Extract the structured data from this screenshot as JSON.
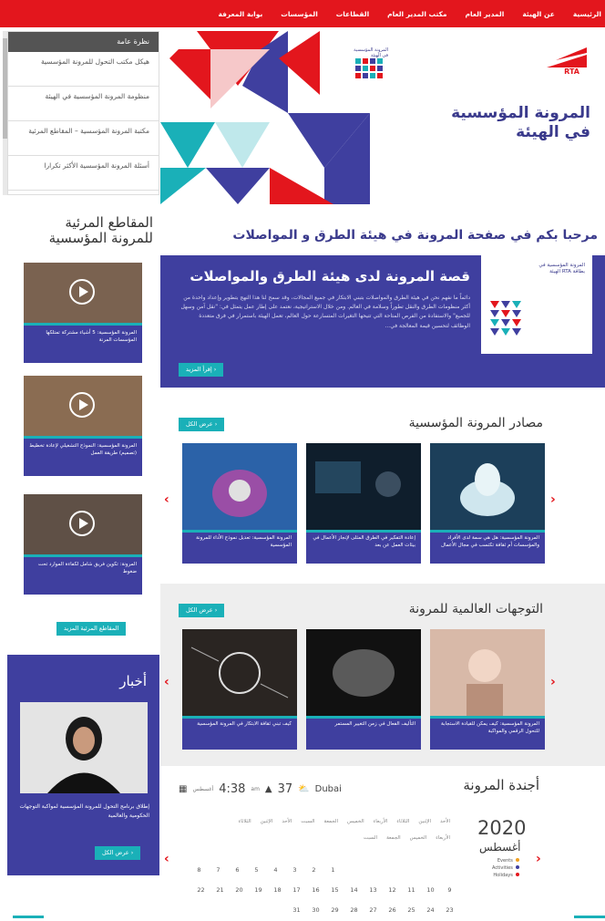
{
  "nav": {
    "items": [
      "الرئيسية",
      "عن الهيئة",
      "المدير العام",
      "مكتب المدير العام",
      "القطاعات",
      "المؤسسات",
      "بوابة المعرفة"
    ]
  },
  "sidebar_menu": {
    "header": "نظرة عامة",
    "items": [
      "هيكل مكتب التحول للمرونة المؤسسية",
      "منظومة المرونة المؤسسية في الهيئة",
      "مكتبة المرونة المؤسسية – المقاطع المرئية",
      "أسئلة المرونة المؤسسية الأكثر تكرارا"
    ]
  },
  "hero": {
    "title_line1": "المرونة المؤسسية",
    "title_line2": "في الهيئة",
    "logo_text": "RTA",
    "sub_label": "المرونة المؤسسية في الهيئة"
  },
  "welcome": "مرحبا بكم في صفحة المرونة في هيئة الطرق و المواصلات",
  "story": {
    "title": "قصة المرونة لدى هيئة الطرق والمواصلات",
    "body": "دائماً ما نفهم نحن في هيئة الطرق والمواصلات بتبني الابتكار في جميع المجالات، وقد سمح لنا هذا النهج بتطوير وإعداد واحدة من أكثر منظومات الطرق والنقل تطوراً وسلامة في العالم. ومن خلال الاستراتيجية، نعتمد على إطار عمل يتمثل في: \"نقل آمن وسهل للجميع\" والاستفادة من الفرص المتاحة التي تتيحها التغيرات المتسارعة حول العالم، تعمل الهيئة باستمرار في فرق متعددة الوظائف لتحسين قيمة المعالجة في...",
    "button": "إقرأ المزيد",
    "card_label": "المرونة المؤسسية في الهيئة RTA بطاقة"
  },
  "sources": {
    "title": "مصادر المرونة المؤسسية",
    "view_all": "عرض الكل",
    "cards": [
      "المرونة المؤسسية: هل هي سمة لدى الأفراد والمؤسسات أم ثقافة تكتسب في مجال الأعمال",
      "إعادة التفكير في الطرق المثلى لإنجاز الأعمال في بيئات العمل عن بعد",
      "المرونة المؤسسية: تعديل نموذج الأداء للمرونة المؤسسية"
    ]
  },
  "trends": {
    "title": "التوجهات العالمية للمرونة",
    "view_all": "عرض الكل",
    "cards": [
      "المرونة المؤسسية: كيف يمكن للقيادة الاستجابة للتحول الرقمي والمواكبة",
      "التأليف الفعال في زمن التغيير المستمر",
      "كيف تبني ثقافة الابتكار في المرونة المؤسسية"
    ]
  },
  "videos": {
    "title_line1": "المقاطع المرئية",
    "title_line2": "للمرونة المؤسسية",
    "items": [
      "المرونة المؤسسية: 5 أشياء مشتركة تمتلكها المؤسسات المرنة",
      "المرونة المؤسسية: النموذج التشغيلي لإعادة تخطيط (تصميم) طريقة العمل",
      "المرونة: تكوين فريق شامل لكفاءة الموارد تحت ضغوط"
    ],
    "button": "المقاطع المرئية المزيد"
  },
  "news": {
    "title": "أخبار",
    "caption": "إطلاق برنامج التحول للمرونة المؤسسية لمواكبة التوجهات الحكومية والعالمية",
    "button": "عرض الكل"
  },
  "agenda": {
    "title": "أجندة المرونة",
    "year": "2020",
    "month": "أغسطس",
    "legend": [
      "Events",
      "Activities",
      "Holidays"
    ],
    "days_row1": [
      "الأحد",
      "الإثنين",
      "الثلاثاء",
      "الأربعاء",
      "الخميس",
      "الجمعة",
      "السبت",
      "الأحد",
      "الإثنين",
      "الثلاثاء"
    ],
    "days_row2": [
      "الأربعاء",
      "الخميس",
      "الجمعة",
      "السبت"
    ],
    "week1": [
      "1",
      "2",
      "3",
      "4",
      "5",
      "6",
      "7",
      "8"
    ],
    "week2": [
      "9",
      "10",
      "11",
      "12",
      "13",
      "14",
      "15",
      "16",
      "17",
      "18",
      "19",
      "20",
      "21",
      "22"
    ],
    "week3": [
      "23",
      "24",
      "25",
      "26",
      "27",
      "28",
      "29",
      "30",
      "31"
    ]
  },
  "weather": {
    "city": "Dubai",
    "temp": "37",
    "time": "4:38",
    "ampm": "am",
    "date": "أغسطس"
  }
}
